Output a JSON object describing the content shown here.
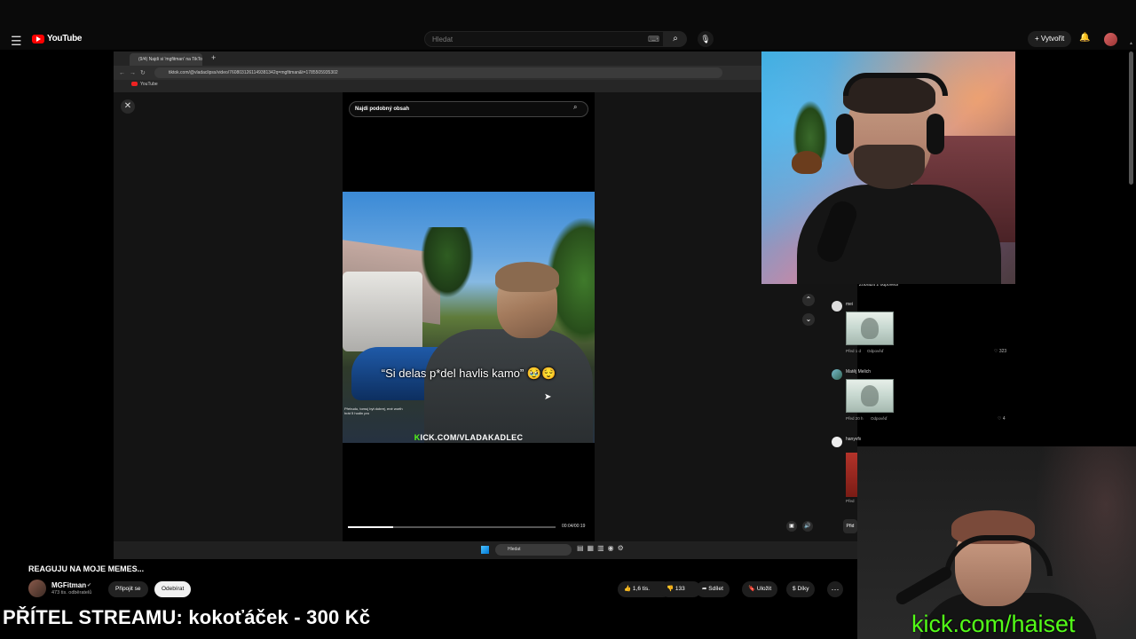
{
  "youtube": {
    "logo_text": "YouTube",
    "search_placeholder": "Hledat",
    "create_label": "Vytvořit",
    "video_title": "REAGUJU NA MOJE MEMES...",
    "channel": {
      "name": "MGFitman",
      "subscribers": "473 tis. odběratelů",
      "join_label": "Připojit se",
      "subscribe_label": "Odebírat"
    },
    "actions": {
      "likes": "1,6 tis.",
      "dislikes": "133",
      "share": "Sdílet",
      "save": "Uložit",
      "thanks": "Díky"
    }
  },
  "browser": {
    "tab_title": "(9/4) Najdi si 'mgfitman' na TikToku",
    "url": "tiktok.com/@vladaclipss/video/7608031261149381342q=mgfitman&t=1785505935302",
    "bookmark": "YouTube"
  },
  "tiktok": {
    "search_placeholder": "Najdi podobný obsah",
    "caption": "“Si delas p*del havlis kamo” 🥹😌",
    "subtitle": "Přebudu, tomuj byt dobrej, ené worth hrát 5 hodin pro",
    "kick_overlay_k": "K",
    "kick_overlay_rest": "ICK.COM/VLADAKADLEC",
    "time": "00:04/00:19",
    "progress": 0.22
  },
  "comments": {
    "show_replies": "Zobrazit 2 odpovědi",
    "items": [
      {
        "user": "mei",
        "time": "Před 1 d",
        "reply": "Odpověď",
        "likes": "323"
      },
      {
        "user": "Matěj Melich",
        "time": "Před 20 h",
        "reply": "Odpověď",
        "likes": "4"
      },
      {
        "user": "hanyvfx",
        "time": "Před",
        "reply": "",
        "likes": ""
      }
    ],
    "input_placeholder": "Přid"
  },
  "taskbar": {
    "search_label": "Hledat"
  },
  "overlay": {
    "banner": "PŘÍTEL STREAMU: kokoťáček - 300 Kč",
    "kick_url": "kick.com/haiset"
  }
}
